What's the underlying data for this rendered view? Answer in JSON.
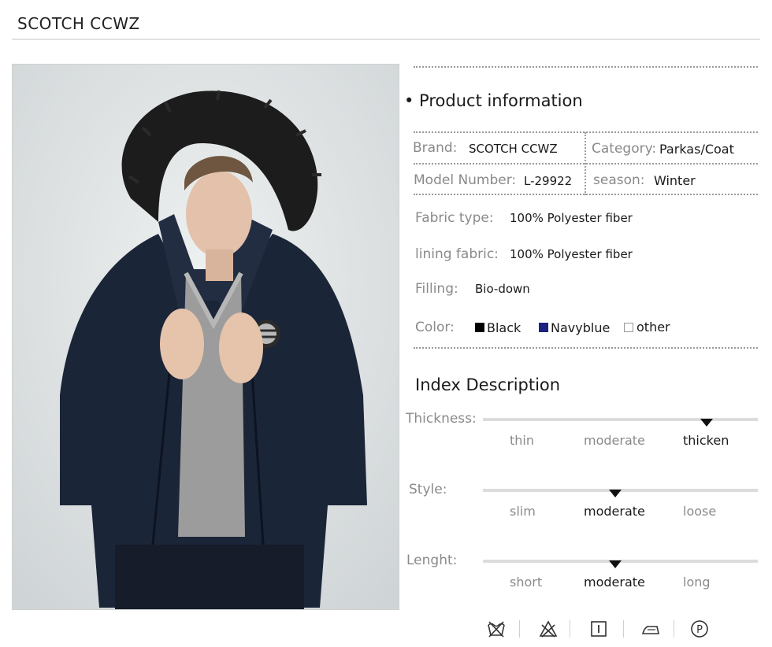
{
  "header": {
    "brand": "SCOTCH CCWZ"
  },
  "product_info": {
    "heading": "• Product information",
    "brand_label": "Brand:",
    "brand_value": "SCOTCH CCWZ",
    "category_label": "Category:",
    "category_value": "Parkas/Coat",
    "model_label": "Model Number:",
    "model_value": "L-29922",
    "season_label": "season:",
    "season_value": "Winter",
    "fabric_label": "Fabric type:",
    "fabric_value": "100% Polyester fiber",
    "lining_label": "lining fabric:",
    "lining_value": "100% Polyester fiber",
    "filling_label": "Filling:",
    "filling_value": "Bio-down",
    "color_label": "Color:",
    "colors": [
      {
        "name": "Black",
        "swatch": "#000000"
      },
      {
        "name": "Navyblue",
        "swatch": "#1a237e"
      },
      {
        "name": "other",
        "swatch": "#ffffff"
      }
    ]
  },
  "index": {
    "heading": "Index Description",
    "rows": [
      {
        "label": "Thickness:",
        "options": [
          "thin",
          "moderate",
          "thicken"
        ],
        "selected": 2
      },
      {
        "label": "Style:",
        "options": [
          "slim",
          "moderate",
          "loose"
        ],
        "selected": 1
      },
      {
        "label": "Lenght:",
        "options": [
          "short",
          "moderate",
          "long"
        ],
        "selected": 1
      }
    ]
  },
  "care_icons": [
    "no-wash-icon",
    "no-bleach-icon",
    "tumble-dry-icon",
    "iron-icon",
    "dry-clean-icon"
  ],
  "colors": {
    "jacket": "#1b2538",
    "sweater": "#9c9c9c",
    "fur": "#1c1c1c",
    "background": "#dfe3e4"
  }
}
